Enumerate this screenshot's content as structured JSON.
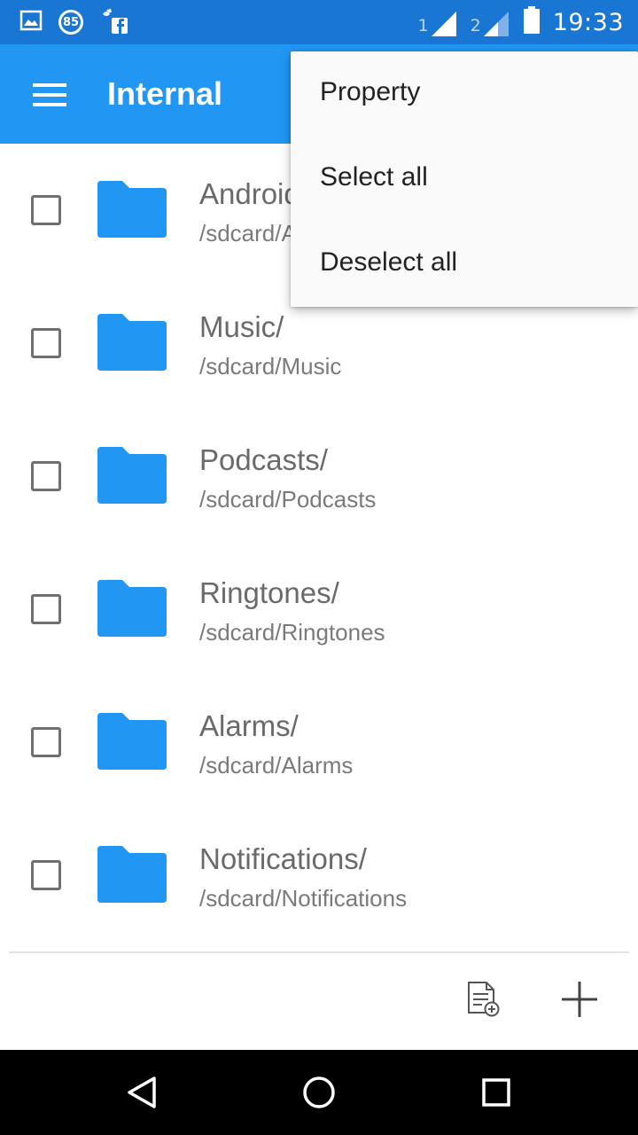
{
  "status_bar": {
    "badge": "85",
    "sim1": "1",
    "sim2": "2",
    "time": "19:33"
  },
  "app_bar": {
    "title": "Internal"
  },
  "menu": {
    "items": [
      {
        "label": "Property"
      },
      {
        "label": "Select all"
      },
      {
        "label": "Deselect all"
      }
    ]
  },
  "files": [
    {
      "name": "Android/",
      "path": "/sdcard/Android"
    },
    {
      "name": "Music/",
      "path": "/sdcard/Music"
    },
    {
      "name": "Podcasts/",
      "path": "/sdcard/Podcasts"
    },
    {
      "name": "Ringtones/",
      "path": "/sdcard/Ringtones"
    },
    {
      "name": "Alarms/",
      "path": "/sdcard/Alarms"
    },
    {
      "name": "Notifications/",
      "path": "/sdcard/Notifications"
    }
  ],
  "colors": {
    "status_bar": "#1976d2",
    "app_bar": "#2196f3",
    "folder": "#2196f3"
  },
  "icons": {
    "status_left": [
      "image-icon",
      "badge-85-icon",
      "facebook-notification-icon"
    ],
    "toolbar": [
      "new-file-icon",
      "add-icon"
    ],
    "nav": [
      "back-icon",
      "home-icon",
      "recents-icon"
    ]
  }
}
